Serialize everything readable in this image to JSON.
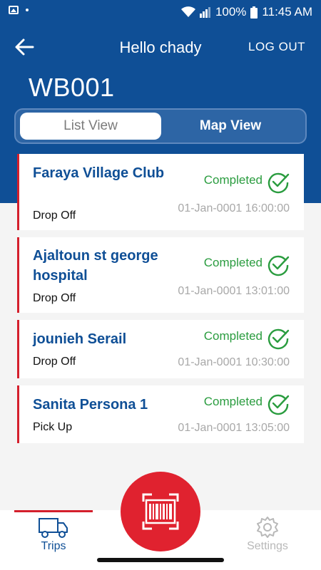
{
  "status_bar": {
    "battery": "100%",
    "time": "11:45 AM",
    "icons": [
      "image-icon",
      "dot-icon",
      "wifi-icon",
      "signal-icon",
      "battery-icon"
    ]
  },
  "header": {
    "title": "Hello chady",
    "logout_label": "LOG OUT",
    "back_icon": "arrow-left-icon",
    "vehicle_id": "WB001"
  },
  "view_toggle": {
    "list_label": "List View",
    "map_label": "Map View",
    "selected": "List View"
  },
  "trips": [
    {
      "name": "Faraya Village Club",
      "type": "Drop Off",
      "status": "Completed",
      "date": "01-Jan-0001 16:00:00"
    },
    {
      "name": "Ajaltoun st george hospital",
      "type": "Drop Off",
      "status": "Completed",
      "date": "01-Jan-0001 13:01:00"
    },
    {
      "name": "jounieh Serail",
      "type": "Drop Off",
      "status": "Completed",
      "date": "01-Jan-0001 10:30:00"
    },
    {
      "name": "Sanita Persona 1",
      "type": "Pick Up",
      "status": "Completed",
      "date": "01-Jan-0001 13:05:00"
    }
  ],
  "bottom_nav": {
    "trips_label": "Trips",
    "settings_label": "Settings",
    "active": "Trips",
    "scan_icon": "barcode-scan-icon"
  },
  "colors": {
    "primary": "#0f4f96",
    "accent": "#d41f2c",
    "success": "#2a9c3f",
    "muted": "#a8a8a8"
  }
}
